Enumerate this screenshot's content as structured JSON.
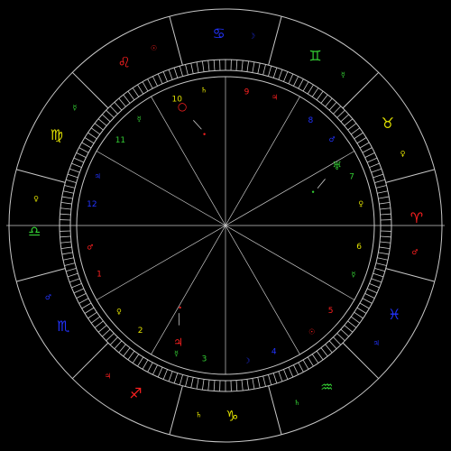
{
  "colors": {
    "background": "#000000",
    "line": "#c8c8c8",
    "fire": "#ff2020",
    "earth": "#33cc33",
    "air": "#e0e000",
    "water": "#2233ff"
  },
  "wheel_glyph_font": "DejaVu Sans",
  "signs": [
    {
      "name": "leo-sign",
      "glyph": "♌",
      "color": "#ff2020",
      "ruler": "☉",
      "ruler_color": "#ff2020"
    },
    {
      "name": "cancer-sign",
      "glyph": "♋",
      "color": "#2233ff",
      "ruler": "☽",
      "ruler_color": "#2233ff"
    },
    {
      "name": "gemini-sign",
      "glyph": "♊",
      "color": "#33cc33",
      "ruler": "☿",
      "ruler_color": "#33cc33"
    },
    {
      "name": "taurus-sign",
      "glyph": "♉",
      "color": "#e0e000",
      "ruler": "♀",
      "ruler_color": "#e0e000"
    },
    {
      "name": "aries-sign",
      "glyph": "♈",
      "color": "#ff2020",
      "ruler": "♂",
      "ruler_color": "#ff2020"
    },
    {
      "name": "pisces-sign",
      "glyph": "♓",
      "color": "#2233ff",
      "ruler": "♃",
      "ruler_color": "#2233ff"
    },
    {
      "name": "aquarius-sign",
      "glyph": "♒",
      "color": "#33cc33",
      "ruler": "♄",
      "ruler_color": "#33cc33"
    },
    {
      "name": "capricorn-sign",
      "glyph": "♑",
      "color": "#e0e000",
      "ruler": "♄",
      "ruler_color": "#e0e000"
    },
    {
      "name": "sagittarius-sign",
      "glyph": "♐",
      "color": "#ff2020",
      "ruler": "♃",
      "ruler_color": "#ff2020"
    },
    {
      "name": "scorpio-sign",
      "glyph": "♏",
      "color": "#2233ff",
      "ruler": "♂",
      "ruler_color": "#2233ff"
    },
    {
      "name": "libra-sign",
      "glyph": "♎",
      "color": "#33cc33",
      "ruler": "♀",
      "ruler_color": "#e0e000"
    },
    {
      "name": "virgo-sign",
      "glyph": "♍",
      "color": "#e0e000",
      "ruler": "☿",
      "ruler_color": "#33cc33"
    }
  ],
  "houses": [
    {
      "label": "10",
      "color": "#e0e000",
      "ruler": "♄",
      "ruler_color": "#e0e000"
    },
    {
      "label": "9",
      "color": "#ff2020",
      "ruler": "♃",
      "ruler_color": "#ff2020"
    },
    {
      "label": "8",
      "color": "#2233ff",
      "ruler": "♂",
      "ruler_color": "#2233ff"
    },
    {
      "label": "7",
      "color": "#33cc33",
      "ruler": "♀",
      "ruler_color": "#e0e000"
    },
    {
      "label": "6",
      "color": "#e0e000",
      "ruler": "☿",
      "ruler_color": "#33cc33"
    },
    {
      "label": "5",
      "color": "#ff2020",
      "ruler": "☉",
      "ruler_color": "#ff2020"
    },
    {
      "label": "4",
      "color": "#2233ff",
      "ruler": "☽",
      "ruler_color": "#2233ff"
    },
    {
      "label": "3",
      "color": "#33cc33",
      "ruler": "☿",
      "ruler_color": "#33cc33"
    },
    {
      "label": "2",
      "color": "#e0e000",
      "ruler": "♀",
      "ruler_color": "#e0e000"
    },
    {
      "label": "1",
      "color": "#ff2020",
      "ruler": "♂",
      "ruler_color": "#ff2020"
    },
    {
      "label": "12",
      "color": "#2233ff",
      "ruler": "♃",
      "ruler_color": "#2233ff"
    },
    {
      "label": "11",
      "color": "#33cc33",
      "ruler": "☿",
      "ruler_color": "#33cc33"
    }
  ],
  "planets": [
    {
      "name": "sun-planet",
      "glyph": "○",
      "color": "#ff2020"
    },
    {
      "name": "uranus-planet",
      "glyph": "♅",
      "color": "#33cc33"
    },
    {
      "name": "jupiter-planet",
      "glyph": "♃",
      "color": "#ff2020"
    }
  ]
}
